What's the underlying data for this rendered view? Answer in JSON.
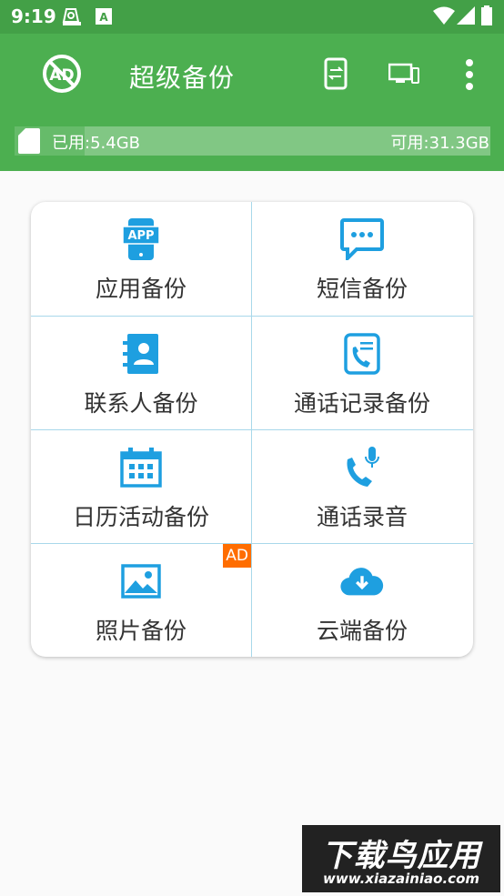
{
  "status_bar": {
    "time": "9:19"
  },
  "app_bar": {
    "title": "超级备份"
  },
  "storage": {
    "used": "已用:5.4GB",
    "free": "可用:31.3GB",
    "used_fraction": 0.147
  },
  "grid": [
    {
      "label": "应用备份",
      "icon": "app-icon"
    },
    {
      "label": "短信备份",
      "icon": "sms-icon"
    },
    {
      "label": "联系人备份",
      "icon": "contacts-icon"
    },
    {
      "label": "通话记录备份",
      "icon": "call-log-icon"
    },
    {
      "label": "日历活动备份",
      "icon": "calendar-icon"
    },
    {
      "label": "通话录音",
      "icon": "call-recording-icon"
    },
    {
      "label": "照片备份",
      "icon": "photo-icon",
      "badge": "AD"
    },
    {
      "label": "云端备份",
      "icon": "cloud-download-icon"
    }
  ],
  "app_icon_text": "APP",
  "watermark": {
    "line1": "下载鸟应用",
    "line2": "www.xiazainiao.com"
  },
  "colors": {
    "primary": "#4caf50",
    "status": "#43a047",
    "accent": "#1e9fe0",
    "ad": "#ff6d00"
  }
}
